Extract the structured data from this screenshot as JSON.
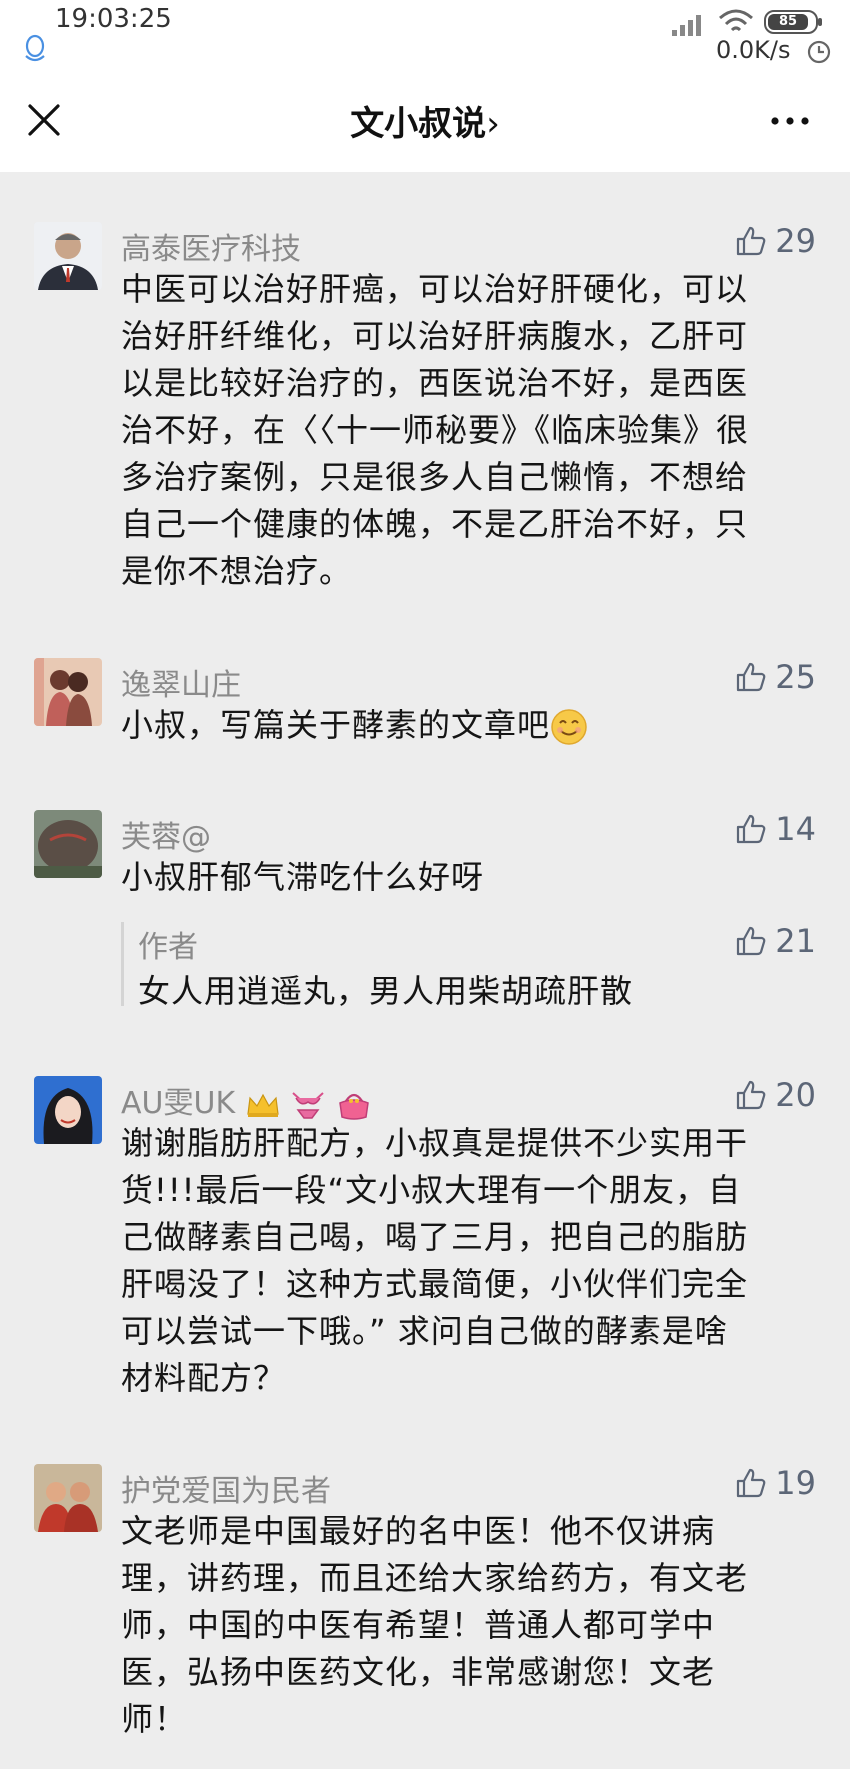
{
  "status_bar": {
    "time": "19:03:25",
    "battery": "85",
    "net_speed": "0.0K/s"
  },
  "nav": {
    "title": "文小叔说",
    "chevron": "›"
  },
  "icons": {
    "close": "close-icon",
    "more": "more-icon",
    "thumb": "thumbs-up-icon",
    "qq": "qq-penguin-icon",
    "signal": "signal-icon",
    "wifi": "wifi-icon",
    "alarm": "alarm-clock-icon"
  },
  "comments": [
    {
      "name": "高泰医疗科技",
      "likes": "29",
      "lines": [
        "中医可以治好肝癌，可以治好肝硬化，可以",
        "治好肝纤维化，可以治好肝病腹水，乙肝可",
        "以是比较好治疗的，西医说治不好，是西医",
        "治不好，在〈〈十一师秘要》《临床验集》很",
        "多治疗案例，只是很多人自己懒惰，不想给",
        "自己一个健康的体魄，不是乙肝治不好，只",
        "是你不想治疗。"
      ]
    },
    {
      "name": "逸翠山庄",
      "likes": "25",
      "lines": [
        "小叔，写篇关于酵素的文章吧"
      ]
    },
    {
      "name": "芙蓉@",
      "likes": "14",
      "lines": [
        "小叔肝郁气滞吃什么好呀"
      ],
      "reply": {
        "name": "作者",
        "likes": "21",
        "text": "女人用逍遥丸，男人用柴胡疏肝散"
      }
    },
    {
      "name": "AU雯UK",
      "likes": "20",
      "lines": [
        "谢谢脂肪肝配方，小叔真是提供不少实用干",
        "货!!!最后一段“文小叔大理有一个朋友，自",
        "己做酵素自己喝，喝了三月，把自己的脂肪",
        "肝喝没了！这种方式最简便，小伙伴们完全",
        "可以尝试一下哦。” 求问自己做的酵素是啥",
        "材料配方？"
      ]
    },
    {
      "name": "护党爱国为民者",
      "likes": "19",
      "lines": [
        "文老师是中国最好的名中医！他不仅讲病",
        "理，讲药理，而且还给大家给药方，有文老",
        "师，中国的中医有希望！普通人都可学中",
        "医，弘扬中医药文化，非常感谢您！文老",
        "师！"
      ]
    }
  ]
}
